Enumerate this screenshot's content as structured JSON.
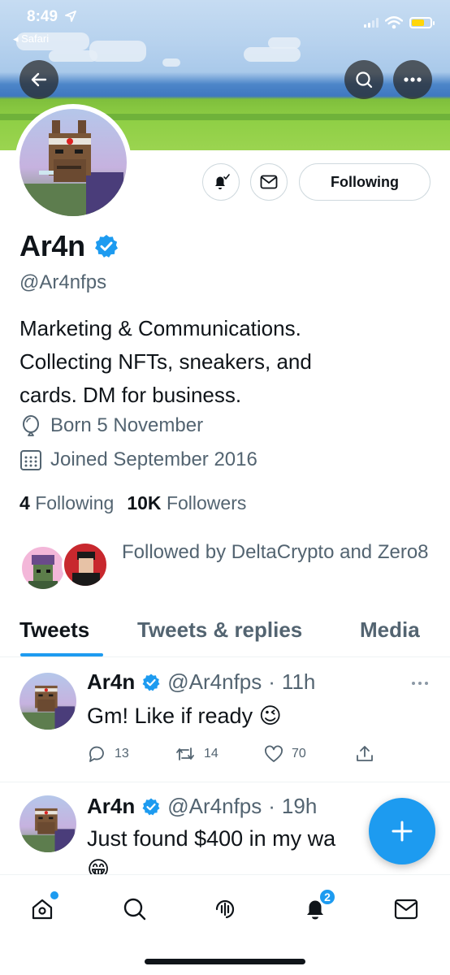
{
  "status_bar": {
    "time": "8:49",
    "back_app": "Safari"
  },
  "profile": {
    "name": "Ar4n",
    "handle": "@Ar4nfps",
    "bio": [
      "Marketing & Communications.",
      "Collecting NFTs, sneakers, and",
      "cards. DM for business."
    ],
    "birthday": "Born 5 November",
    "joined": "Joined September 2016",
    "following_count": "4",
    "following_label": "Following",
    "followers_count": "10K",
    "followers_label": "Followers",
    "followed_by": "Followed by DeltaCrypto and Zero8",
    "follow_button": "Following"
  },
  "tabs": [
    "Tweets",
    "Tweets & replies",
    "Media"
  ],
  "tweets": [
    {
      "name": "Ar4n",
      "handle": "@Ar4nfps",
      "dot": "·",
      "time": "11h",
      "text": "Gm! Like if ready 😉",
      "replies": "13",
      "retweets": "14",
      "likes": "70"
    },
    {
      "name": "Ar4n",
      "handle": "@Ar4nfps",
      "dot": "·",
      "time": "19h",
      "text": "Just found $400 in my wa",
      "text_line2": "😁"
    }
  ],
  "nav": {
    "notification_badge": "2"
  },
  "colors": {
    "accent": "#1d9bf0",
    "text": "#0f1419",
    "muted": "#536471"
  }
}
